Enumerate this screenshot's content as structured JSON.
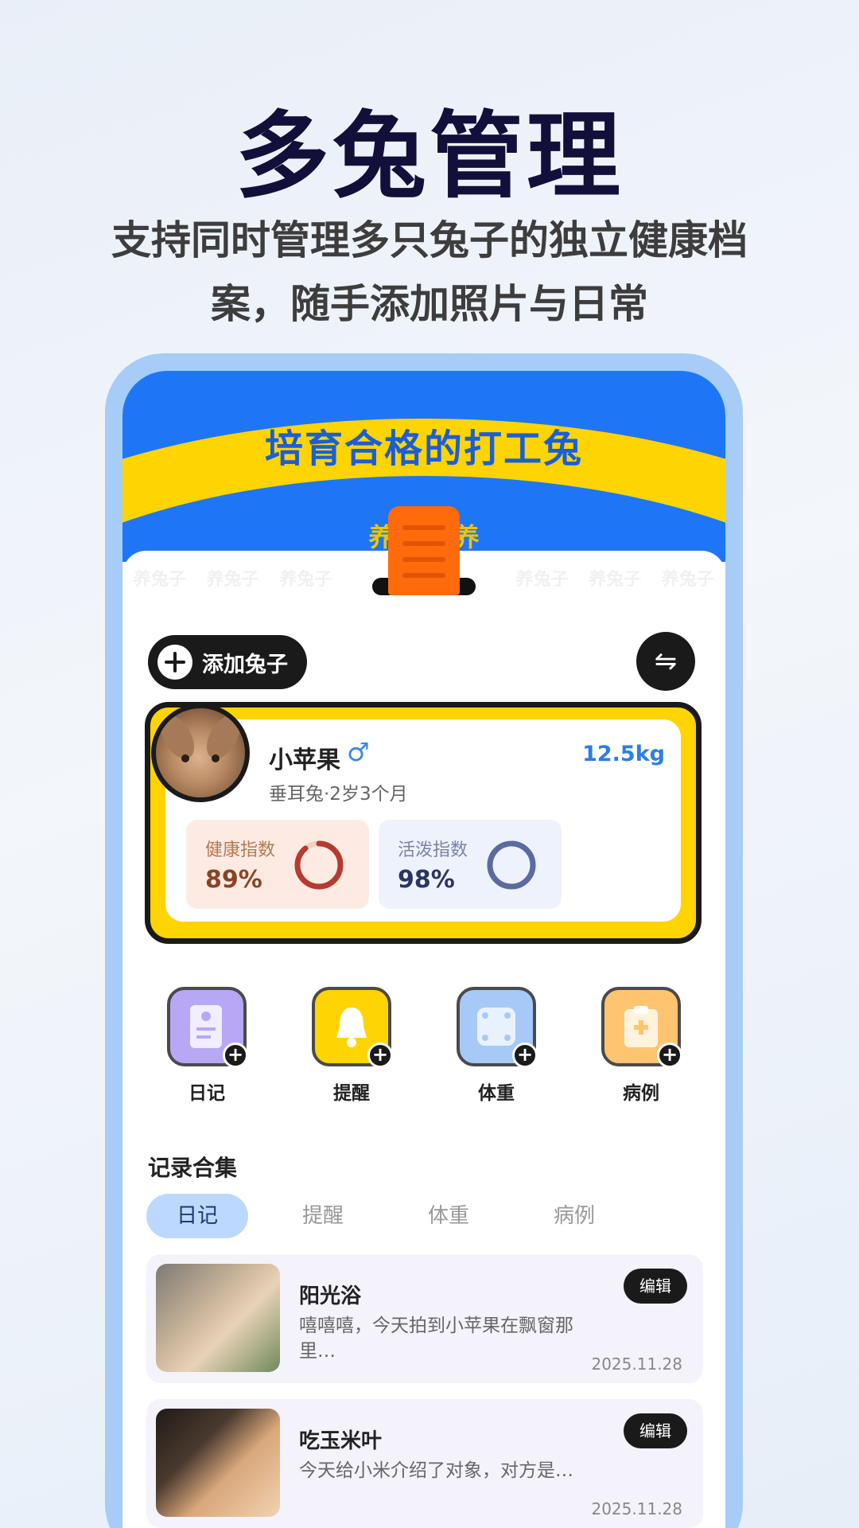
{
  "hero": {
    "title": "多兔管理",
    "subtitle_line1": "支持同时管理多只兔子的独立健康档",
    "subtitle_line2": "案，随手添加照片与日常"
  },
  "banner": {
    "title": "培育合格的打工兔",
    "slogan": "养好        好养",
    "watermark": [
      "养兔子",
      "养兔子",
      "养兔子",
      "养兔子",
      "养兔子",
      "养兔子"
    ]
  },
  "actions": {
    "add_rabbit_label": "添加兔子",
    "switch_icon": "⇋"
  },
  "rabbit": {
    "name": "小苹果",
    "gender_icon": "♂",
    "weight": "12.5kg",
    "meta": "垂耳兔·2岁3个月",
    "health_label": "健康指数",
    "health_value": "89%",
    "health_fraction": 0.89,
    "active_label": "活泼指数",
    "active_value": "98%",
    "active_fraction": 0.98
  },
  "quick_actions": [
    {
      "label": "日记",
      "icon": "diary-icon"
    },
    {
      "label": "提醒",
      "icon": "bell-icon"
    },
    {
      "label": "体重",
      "icon": "scale-icon"
    },
    {
      "label": "病例",
      "icon": "clipboard-icon"
    }
  ],
  "records": {
    "section_title": "记录合集",
    "tabs": [
      "日记",
      "提醒",
      "体重",
      "病例"
    ],
    "active_tab": "日记",
    "items": [
      {
        "title": "阳光浴",
        "text": "嘻嘻嘻，今天拍到小苹果在飘窗那里…",
        "date": "2025.11.28",
        "edit_label": "编辑"
      },
      {
        "title": "吃玉米叶",
        "text": "今天给小米介绍了对象，对方是…",
        "date": "2025.11.28",
        "edit_label": "编辑"
      }
    ]
  },
  "colors": {
    "accent_blue": "#1e76f6",
    "accent_yellow": "#ffd400",
    "health_ring": "#b63a2f",
    "active_ring": "#5a6aa3"
  }
}
